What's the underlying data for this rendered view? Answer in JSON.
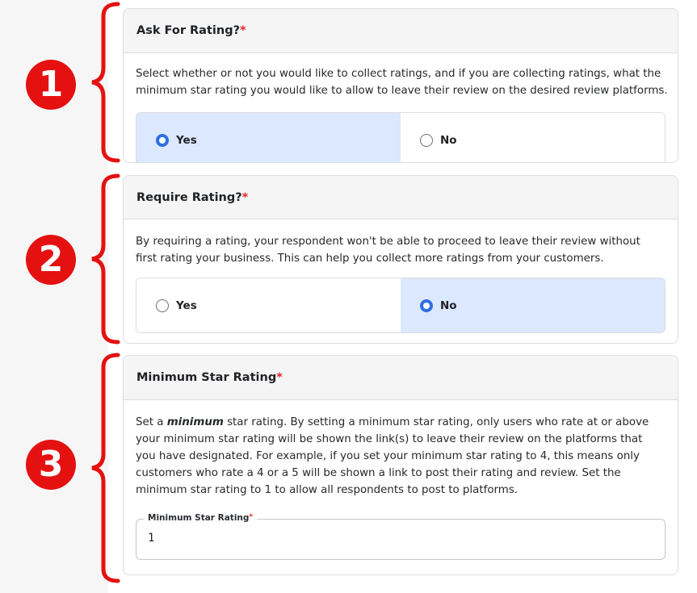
{
  "markers": [
    {
      "number": "1"
    },
    {
      "number": "2"
    },
    {
      "number": "3"
    }
  ],
  "colors": {
    "marker_red": "#e51111",
    "required_star": "#e3232a",
    "selected_bg": "#dbe8fe",
    "radio_selected": "#2f6fe4"
  },
  "sections": {
    "ask_rating": {
      "title": "Ask For Rating?",
      "required": "*",
      "description_line1": "Select whether or not you would like to collect ratings, and if you are collecting ratings, what the",
      "description_line2": "minimum star rating you would like to allow to leave their review on the desired review platforms.",
      "options": [
        {
          "label": "Yes",
          "selected": true
        },
        {
          "label": "No",
          "selected": false
        }
      ]
    },
    "require_rating": {
      "title": "Require Rating?",
      "required": "*",
      "description_line1": "By requiring a rating, your respondent won't be able to proceed to leave their review without",
      "description_line2": "first rating your business. This can help you collect more ratings from your customers.",
      "options": [
        {
          "label": "Yes",
          "selected": false
        },
        {
          "label": "No",
          "selected": true
        }
      ]
    },
    "min_star": {
      "title": "Minimum Star Rating",
      "required": "*",
      "description_prefix": "Set a ",
      "description_emphasis": "minimum",
      "description_line1_rest": " star rating. By setting a minimum star rating, only users who rate at or above",
      "description_line2": "your minimum star rating will be shown the link(s) to leave their review on the platforms that",
      "description_line3": "you have designated. For example, if you set your minimum star rating to 4, this means only",
      "description_line4": "customers who rate a 4 or a 5 will be shown a link to post their rating and review. Set the",
      "description_line5": "minimum star rating to 1 to allow all respondents to post to platforms.",
      "field_label": "Minimum Star Rating",
      "field_required": "*",
      "field_value": "1"
    }
  }
}
